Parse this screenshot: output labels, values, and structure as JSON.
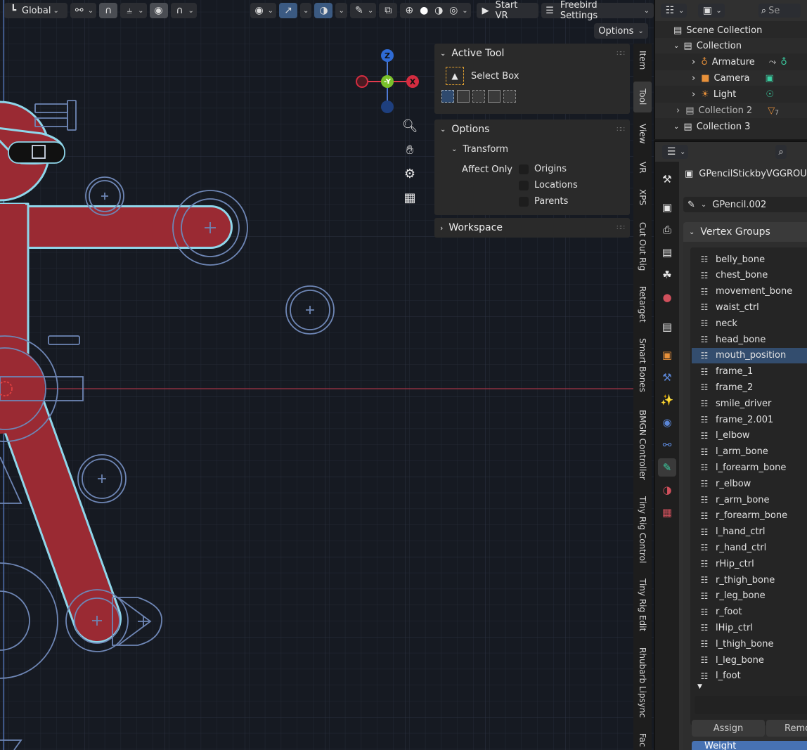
{
  "viewport_header": {
    "transform_orientation": "Global",
    "start_vr": "Start VR",
    "freebird_settings": "Freebird Settings",
    "options": "Options"
  },
  "active_tool_panel": {
    "title": "Active Tool",
    "tool_name": "Select Box",
    "options_title": "Options",
    "transform_title": "Transform",
    "affect_only": "Affect Only",
    "checkboxes": [
      {
        "label": "Origins",
        "checked": false
      },
      {
        "label": "Locations",
        "checked": false
      },
      {
        "label": "Parents",
        "checked": false
      }
    ],
    "workspace_title": "Workspace"
  },
  "gizmo": {
    "z": "Z",
    "y": "-Y",
    "x": "X"
  },
  "sidebar_tabs": [
    "Item",
    "Tool",
    "View",
    "VR",
    "XPS",
    "Cut Out Rig",
    "Retarget",
    "Smart Bones",
    "BMGN Controller",
    "Tiny Rig Control",
    "Tiny Rig Edit",
    "Rhubarb Lipsync",
    "Fac"
  ],
  "sidebar_active_tab": "Tool",
  "outliner": {
    "search_placeholder": "Se",
    "items": [
      {
        "label": "Scene Collection"
      },
      {
        "label": "Collection"
      },
      {
        "label": "Armature"
      },
      {
        "label": "Camera"
      },
      {
        "label": "Light"
      },
      {
        "label": "Collection 2",
        "badge": "7"
      },
      {
        "label": "Collection 3"
      }
    ]
  },
  "properties": {
    "object_name": "GPencilStickbyVGGROUP",
    "data_name": "GPencil.002",
    "vertex_groups_title": "Vertex Groups",
    "vertex_groups": [
      "belly_bone",
      "chest_bone",
      "movement_bone",
      "waist_ctrl",
      "neck",
      "head_bone",
      "mouth_position",
      "frame_1",
      "frame_2",
      "smile_driver",
      "frame_2.001",
      "l_elbow",
      "l_arm_bone",
      "l_forearm_bone",
      "r_elbow",
      "r_arm_bone",
      "r_forearm_bone",
      "l_hand_ctrl",
      "r_hand_ctrl",
      "rHip_ctrl",
      "r_thigh_bone",
      "r_leg_bone",
      "r_foot",
      "lHip_ctrl",
      "l_thigh_bone",
      "l_leg_bone",
      "l_foot"
    ],
    "selected_group": "mouth_position",
    "assign": "Assign",
    "remove": "Remo",
    "weight": "Weight"
  },
  "colors": {
    "accent_blue": "#3b5a82",
    "figure_red": "#9a2a33",
    "stroke_cyan": "#8fd6ea",
    "bone_blue": "#6e86b5"
  }
}
